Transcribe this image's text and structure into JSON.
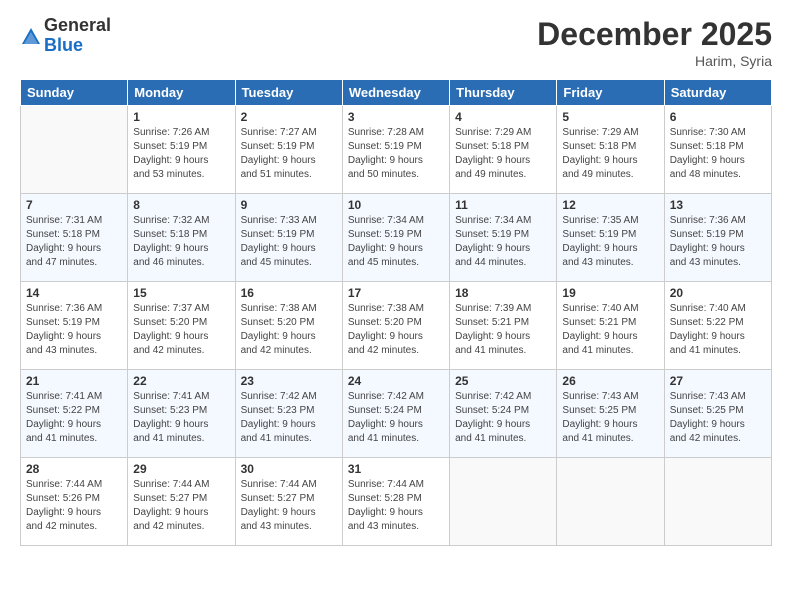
{
  "logo": {
    "general": "General",
    "blue": "Blue"
  },
  "header": {
    "month": "December 2025",
    "location": "Harim, Syria"
  },
  "weekdays": [
    "Sunday",
    "Monday",
    "Tuesday",
    "Wednesday",
    "Thursday",
    "Friday",
    "Saturday"
  ],
  "weeks": [
    [
      {
        "day": "",
        "info": ""
      },
      {
        "day": "1",
        "info": "Sunrise: 7:26 AM\nSunset: 5:19 PM\nDaylight: 9 hours\nand 53 minutes."
      },
      {
        "day": "2",
        "info": "Sunrise: 7:27 AM\nSunset: 5:19 PM\nDaylight: 9 hours\nand 51 minutes."
      },
      {
        "day": "3",
        "info": "Sunrise: 7:28 AM\nSunset: 5:19 PM\nDaylight: 9 hours\nand 50 minutes."
      },
      {
        "day": "4",
        "info": "Sunrise: 7:29 AM\nSunset: 5:18 PM\nDaylight: 9 hours\nand 49 minutes."
      },
      {
        "day": "5",
        "info": "Sunrise: 7:29 AM\nSunset: 5:18 PM\nDaylight: 9 hours\nand 49 minutes."
      },
      {
        "day": "6",
        "info": "Sunrise: 7:30 AM\nSunset: 5:18 PM\nDaylight: 9 hours\nand 48 minutes."
      }
    ],
    [
      {
        "day": "7",
        "info": "Sunrise: 7:31 AM\nSunset: 5:18 PM\nDaylight: 9 hours\nand 47 minutes."
      },
      {
        "day": "8",
        "info": "Sunrise: 7:32 AM\nSunset: 5:18 PM\nDaylight: 9 hours\nand 46 minutes."
      },
      {
        "day": "9",
        "info": "Sunrise: 7:33 AM\nSunset: 5:19 PM\nDaylight: 9 hours\nand 45 minutes."
      },
      {
        "day": "10",
        "info": "Sunrise: 7:34 AM\nSunset: 5:19 PM\nDaylight: 9 hours\nand 45 minutes."
      },
      {
        "day": "11",
        "info": "Sunrise: 7:34 AM\nSunset: 5:19 PM\nDaylight: 9 hours\nand 44 minutes."
      },
      {
        "day": "12",
        "info": "Sunrise: 7:35 AM\nSunset: 5:19 PM\nDaylight: 9 hours\nand 43 minutes."
      },
      {
        "day": "13",
        "info": "Sunrise: 7:36 AM\nSunset: 5:19 PM\nDaylight: 9 hours\nand 43 minutes."
      }
    ],
    [
      {
        "day": "14",
        "info": "Sunrise: 7:36 AM\nSunset: 5:19 PM\nDaylight: 9 hours\nand 43 minutes."
      },
      {
        "day": "15",
        "info": "Sunrise: 7:37 AM\nSunset: 5:20 PM\nDaylight: 9 hours\nand 42 minutes."
      },
      {
        "day": "16",
        "info": "Sunrise: 7:38 AM\nSunset: 5:20 PM\nDaylight: 9 hours\nand 42 minutes."
      },
      {
        "day": "17",
        "info": "Sunrise: 7:38 AM\nSunset: 5:20 PM\nDaylight: 9 hours\nand 42 minutes."
      },
      {
        "day": "18",
        "info": "Sunrise: 7:39 AM\nSunset: 5:21 PM\nDaylight: 9 hours\nand 41 minutes."
      },
      {
        "day": "19",
        "info": "Sunrise: 7:40 AM\nSunset: 5:21 PM\nDaylight: 9 hours\nand 41 minutes."
      },
      {
        "day": "20",
        "info": "Sunrise: 7:40 AM\nSunset: 5:22 PM\nDaylight: 9 hours\nand 41 minutes."
      }
    ],
    [
      {
        "day": "21",
        "info": "Sunrise: 7:41 AM\nSunset: 5:22 PM\nDaylight: 9 hours\nand 41 minutes."
      },
      {
        "day": "22",
        "info": "Sunrise: 7:41 AM\nSunset: 5:23 PM\nDaylight: 9 hours\nand 41 minutes."
      },
      {
        "day": "23",
        "info": "Sunrise: 7:42 AM\nSunset: 5:23 PM\nDaylight: 9 hours\nand 41 minutes."
      },
      {
        "day": "24",
        "info": "Sunrise: 7:42 AM\nSunset: 5:24 PM\nDaylight: 9 hours\nand 41 minutes."
      },
      {
        "day": "25",
        "info": "Sunrise: 7:42 AM\nSunset: 5:24 PM\nDaylight: 9 hours\nand 41 minutes."
      },
      {
        "day": "26",
        "info": "Sunrise: 7:43 AM\nSunset: 5:25 PM\nDaylight: 9 hours\nand 41 minutes."
      },
      {
        "day": "27",
        "info": "Sunrise: 7:43 AM\nSunset: 5:25 PM\nDaylight: 9 hours\nand 42 minutes."
      }
    ],
    [
      {
        "day": "28",
        "info": "Sunrise: 7:44 AM\nSunset: 5:26 PM\nDaylight: 9 hours\nand 42 minutes."
      },
      {
        "day": "29",
        "info": "Sunrise: 7:44 AM\nSunset: 5:27 PM\nDaylight: 9 hours\nand 42 minutes."
      },
      {
        "day": "30",
        "info": "Sunrise: 7:44 AM\nSunset: 5:27 PM\nDaylight: 9 hours\nand 43 minutes."
      },
      {
        "day": "31",
        "info": "Sunrise: 7:44 AM\nSunset: 5:28 PM\nDaylight: 9 hours\nand 43 minutes."
      },
      {
        "day": "",
        "info": ""
      },
      {
        "day": "",
        "info": ""
      },
      {
        "day": "",
        "info": ""
      }
    ]
  ]
}
